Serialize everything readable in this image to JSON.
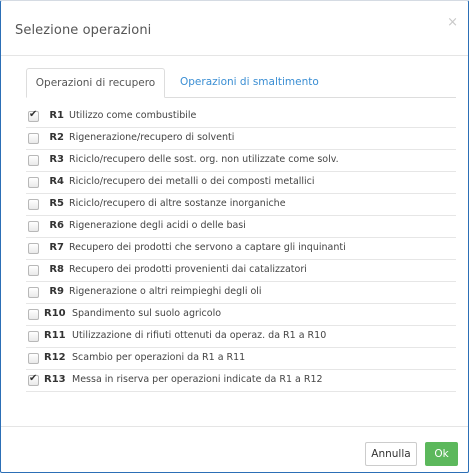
{
  "dialog": {
    "title": "Selezione operazioni",
    "close_symbol": "×"
  },
  "tabs": [
    {
      "label": "Operazioni di recupero",
      "active": true
    },
    {
      "label": "Operazioni di smaltimento",
      "active": false
    }
  ],
  "operations": [
    {
      "code": "R1",
      "description": "Utilizzo come combustibile",
      "checked": true
    },
    {
      "code": "R2",
      "description": "Rigenerazione/recupero di solventi",
      "checked": false
    },
    {
      "code": "R3",
      "description": "Riciclo/recupero delle sost. org. non utilizzate come solv.",
      "checked": false
    },
    {
      "code": "R4",
      "description": "Riciclo/recupero dei metalli o dei composti metallici",
      "checked": false
    },
    {
      "code": "R5",
      "description": "Riciclo/recupero di altre sostanze inorganiche",
      "checked": false
    },
    {
      "code": "R6",
      "description": "Rigenerazione degli acidi o delle basi",
      "checked": false
    },
    {
      "code": "R7",
      "description": "Recupero dei prodotti che servono a captare gli inquinanti",
      "checked": false
    },
    {
      "code": "R8",
      "description": "Recupero dei prodotti provenienti dai catalizzatori",
      "checked": false
    },
    {
      "code": "R9",
      "description": "Rigenerazione o altri reimpieghi degli oli",
      "checked": false
    },
    {
      "code": "R10",
      "description": "Spandimento sul suolo agricolo",
      "checked": false
    },
    {
      "code": "R11",
      "description": "Utilizzazione di rifiuti ottenuti da operaz. da R1 a R10",
      "checked": false
    },
    {
      "code": "R12",
      "description": "Scambio per operazioni da R1 a R11",
      "checked": false
    },
    {
      "code": "R13",
      "description": "Messa in riserva per operazioni indicate da R1 a R12",
      "checked": true
    }
  ],
  "footer": {
    "cancel_label": "Annulla",
    "ok_label": "Ok"
  },
  "colors": {
    "accent": "#3a8ed3",
    "ok_button": "#5cb85c",
    "border": "#2c6fb6"
  }
}
